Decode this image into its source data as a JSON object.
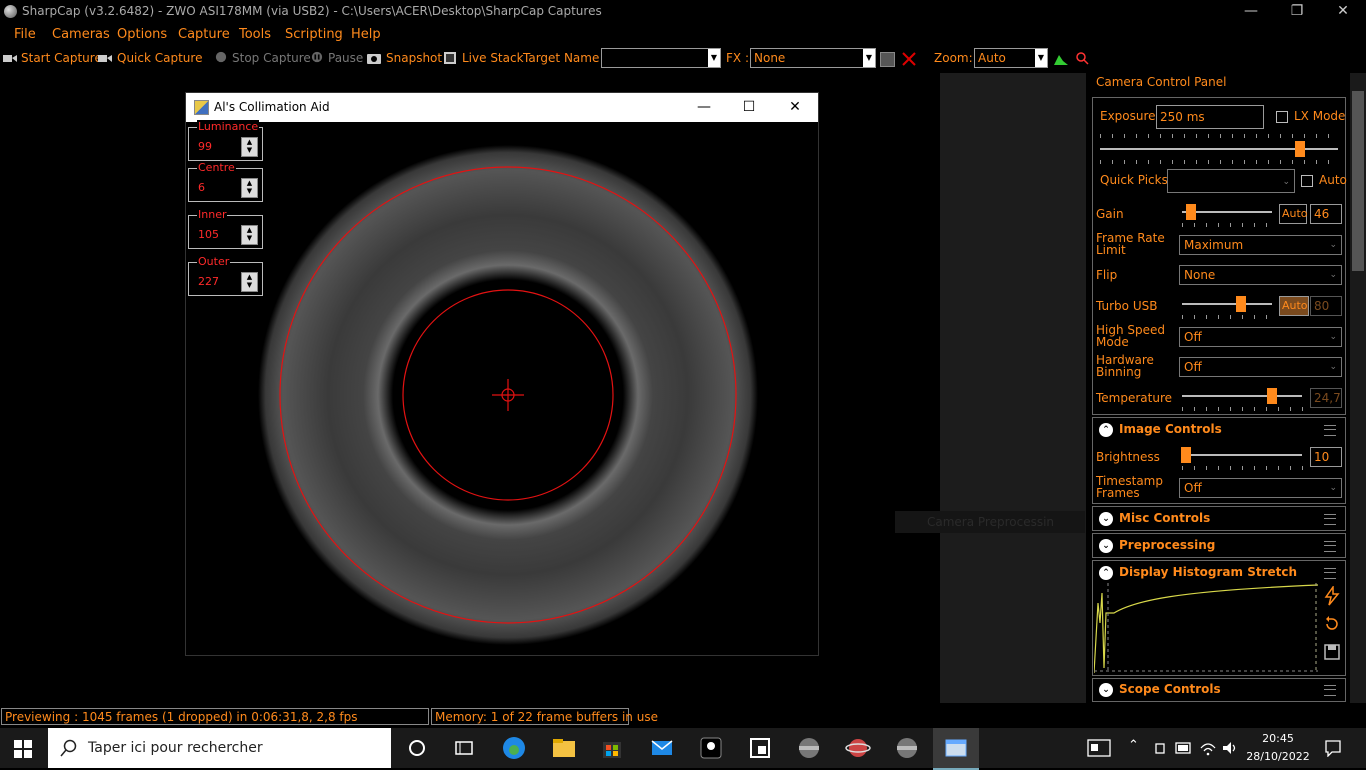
{
  "window": {
    "title": "SharpCap (v3.2.6482) - ZWO ASI178MM (via USB2) - C:\\Users\\ACER\\Desktop\\SharpCap Captures",
    "controls": {
      "minimize": "—",
      "restore": "❐",
      "close": "✕"
    }
  },
  "menu": [
    "File",
    "Cameras",
    "Options",
    "Capture",
    "Tools",
    "Scripting",
    "Help"
  ],
  "toolbar": {
    "start_capture": "Start Capture",
    "quick_capture": "Quick Capture",
    "stop_capture": "Stop Capture",
    "pause": "Pause",
    "snapshot": "Snapshot",
    "live_stack": "Live Stack",
    "target_name_label": "Target Name :",
    "target_name_value": "",
    "fx_label": "FX :",
    "fx_value": "None",
    "zoom_label": "Zoom:",
    "zoom_value": "Auto"
  },
  "collimation": {
    "title": "Al's Collimation Aid",
    "fields": [
      {
        "label": "Luminance",
        "value": "99"
      },
      {
        "label": "Centre",
        "value": "6"
      },
      {
        "label": "Inner",
        "value": "105"
      },
      {
        "label": "Outer",
        "value": "227"
      }
    ]
  },
  "preview_overlay_text": "Camera Preprocessin",
  "camera_panel": {
    "title": "Camera Control Panel",
    "exposure_label": "Exposure",
    "exposure_value": "250 ms",
    "lx_mode_label": "LX Mode",
    "quick_picks_label": "Quick Picks",
    "quick_picks_value": "",
    "auto_label": "Auto",
    "gain_label": "Gain",
    "gain_auto": "Auto",
    "gain_value": "46",
    "frame_rate_label": "Frame Rate Limit",
    "frame_rate_value": "Maximum",
    "flip_label": "Flip",
    "flip_value": "None",
    "turbo_label": "Turbo USB",
    "turbo_auto": "Auto",
    "turbo_value": "80",
    "hsm_label": "High Speed Mode",
    "hsm_value": "Off",
    "binning_label": "Hardware Binning",
    "binning_value": "Off",
    "temperature_label": "Temperature",
    "temperature_value": "24,7",
    "levels": {
      "exposure": 0.84,
      "gain": 0.1,
      "turbo": 0.65,
      "temperature": 0.75,
      "brightness": 0.03
    }
  },
  "image_controls": {
    "title": "Image Controls",
    "brightness_label": "Brightness",
    "brightness_value": "10",
    "timestamp_label": "Timestamp Frames",
    "timestamp_value": "Off"
  },
  "sections": {
    "misc": "Misc Controls",
    "preprocessing": "Preprocessing",
    "histogram": "Display Histogram Stretch",
    "scope": "Scope Controls"
  },
  "status": {
    "previewing": "Previewing : 1045 frames (1 dropped) in 0:06:31,8, 2,8 fps",
    "memory": "Memory: 1 of 22 frame buffers in use"
  },
  "taskbar": {
    "search_placeholder": "Taper ici pour rechercher",
    "time": "20:45",
    "date": "28/10/2022"
  },
  "colors": {
    "accent": "#ff8a1c",
    "reticle": "#ff2a2a"
  }
}
